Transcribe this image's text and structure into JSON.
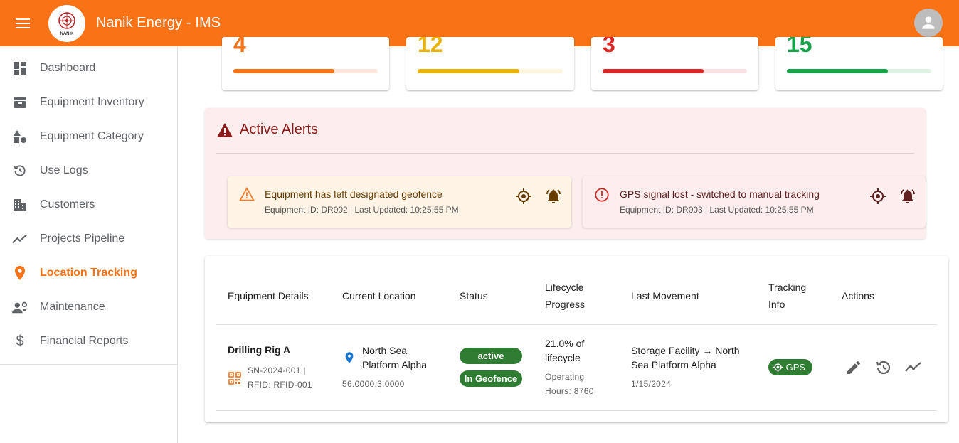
{
  "app": {
    "title": "Nanik Energy - IMS",
    "logo_text": "NANIK"
  },
  "sidebar": {
    "items": [
      {
        "label": "Dashboard",
        "icon": "dashboard-icon"
      },
      {
        "label": "Equipment Inventory",
        "icon": "archive-icon"
      },
      {
        "label": "Equipment Category",
        "icon": "category-icon"
      },
      {
        "label": "Use Logs",
        "icon": "history-icon"
      },
      {
        "label": "Customers",
        "icon": "building-icon"
      },
      {
        "label": "Projects Pipeline",
        "icon": "trending-icon"
      },
      {
        "label": "Location Tracking",
        "icon": "location-pin-icon",
        "active": true
      },
      {
        "label": "Maintenance",
        "icon": "engineering-icon"
      },
      {
        "label": "Financial Reports",
        "icon": "dollar-icon"
      }
    ]
  },
  "stats": [
    {
      "value": "4",
      "color": "#f97316",
      "progress": 0.7
    },
    {
      "value": "12",
      "color": "#eab308",
      "progress": 0.7
    },
    {
      "value": "3",
      "color": "#dc2626",
      "progress": 0.7
    },
    {
      "value": "15",
      "color": "#16a34a",
      "progress": 0.7
    }
  ],
  "alerts": {
    "title": "Active Alerts",
    "items": [
      {
        "title": "Equipment has left designated geofence",
        "subtitle": "Equipment ID: DR002 | Last Updated: 10:25:55 PM",
        "severity": "warning"
      },
      {
        "title": "GPS signal lost - switched to manual tracking",
        "subtitle": "Equipment ID: DR003 | Last Updated: 10:25:55 PM",
        "severity": "error"
      }
    ]
  },
  "table": {
    "headers": {
      "details": "Equipment Details",
      "location": "Current Location",
      "status": "Status",
      "lifecycle_1": "Lifecycle",
      "lifecycle_2": "Progress",
      "movement": "Last Movement",
      "tracking_1": "Tracking",
      "tracking_2": "Info",
      "actions": "Actions"
    },
    "rows": [
      {
        "name": "Drilling Rig A",
        "serial_line": "SN-2024-001 |",
        "rfid_line": "RFID: RFID-001",
        "location_1": "North Sea",
        "location_2": "Platform Alpha",
        "coords": "56.0000,3.0000",
        "status": "active",
        "geofence": "In Geofence",
        "lifecycle_1": "21.0% of",
        "lifecycle_2": "lifecycle",
        "hours_1": "Operating",
        "hours_2": "Hours: 8760",
        "movement_1": "Storage Facility → North",
        "movement_2": "Sea Platform Alpha",
        "movement_date": "1/15/2024",
        "tracking": "GPS"
      }
    ]
  },
  "colors": {
    "primary": "#f97316",
    "alert_bg": "#fdeeee",
    "success": "#2e7d32"
  }
}
